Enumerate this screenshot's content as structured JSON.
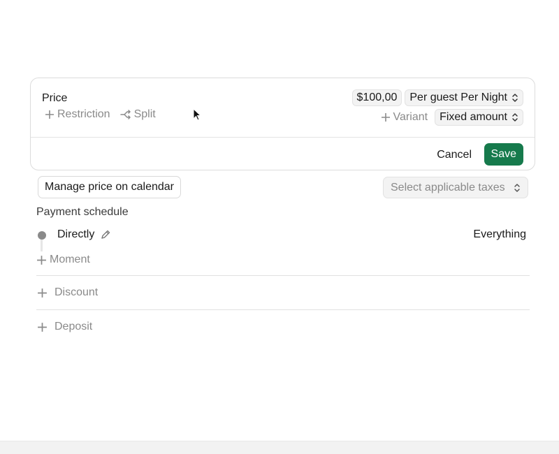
{
  "price_card": {
    "title": "Price",
    "restriction_label": "Restriction",
    "split_label": "Split",
    "amount": "$100,00",
    "unit_select": "Per guest Per Night",
    "variant_label": "Variant",
    "amount_type_select": "Fixed amount",
    "cancel_label": "Cancel",
    "save_label": "Save"
  },
  "manage_calendar_label": "Manage price on calendar",
  "tax_select_placeholder": "Select applicable taxes",
  "payment_schedule": {
    "title": "Payment schedule",
    "moment_name": "Directly",
    "moment_value": "Everything",
    "add_moment_label": "Moment"
  },
  "add_discount_label": "Discount",
  "add_deposit_label": "Deposit",
  "colors": {
    "save_button": "#167a4c",
    "muted_text": "#8a8a8a"
  }
}
